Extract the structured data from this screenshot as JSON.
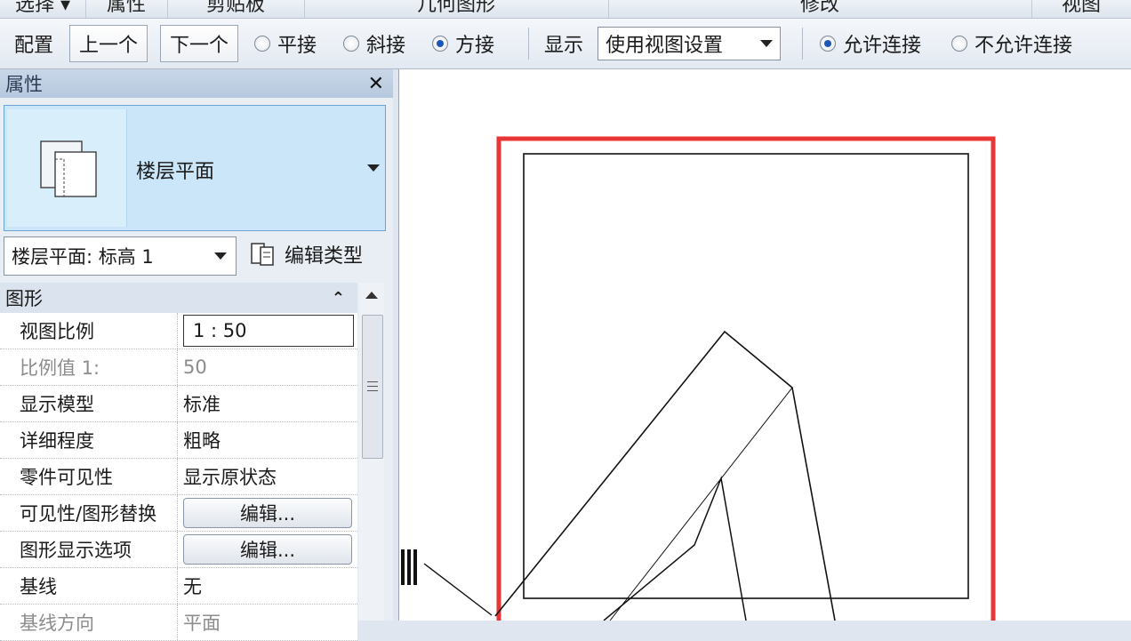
{
  "ribbon": {
    "groups": [
      "选择 ▾",
      "属性",
      "剪贴板",
      "几何图形",
      "修改",
      "视图"
    ]
  },
  "options_bar": {
    "config_label": "配置",
    "prev_label": "上一个",
    "next_label": "下一个",
    "join_options": [
      {
        "label": "平接",
        "selected": false
      },
      {
        "label": "斜接",
        "selected": false
      },
      {
        "label": "方接",
        "selected": true
      }
    ],
    "display_label": "显示",
    "display_value": "使用视图设置",
    "connect_options": [
      {
        "label": "允许连接",
        "selected": true
      },
      {
        "label": "不允许连接",
        "selected": false
      }
    ]
  },
  "properties": {
    "title": "属性",
    "close_glyph": "✕",
    "type_name": "楼层平面",
    "instance_value": "楼层平面: 标高 1",
    "edit_type_label": "编辑类型",
    "section_label": "图形",
    "rows": [
      {
        "key": "视图比例",
        "value": "1 : 50"
      },
      {
        "key": "比例值 1:",
        "value": "50"
      },
      {
        "key": "显示模型",
        "value": "标准"
      },
      {
        "key": "详细程度",
        "value": "粗略"
      },
      {
        "key": "零件可见性",
        "value": "显示原状态"
      },
      {
        "key": "可见性/图形替换",
        "value": "编辑..."
      },
      {
        "key": "图形显示选项",
        "value": "编辑..."
      },
      {
        "key": "基线",
        "value": "无"
      },
      {
        "key": "基线方向",
        "value": "平面"
      }
    ]
  },
  "colors": {
    "selection_highlight": "#e83535",
    "accent": "#1d57b6"
  }
}
